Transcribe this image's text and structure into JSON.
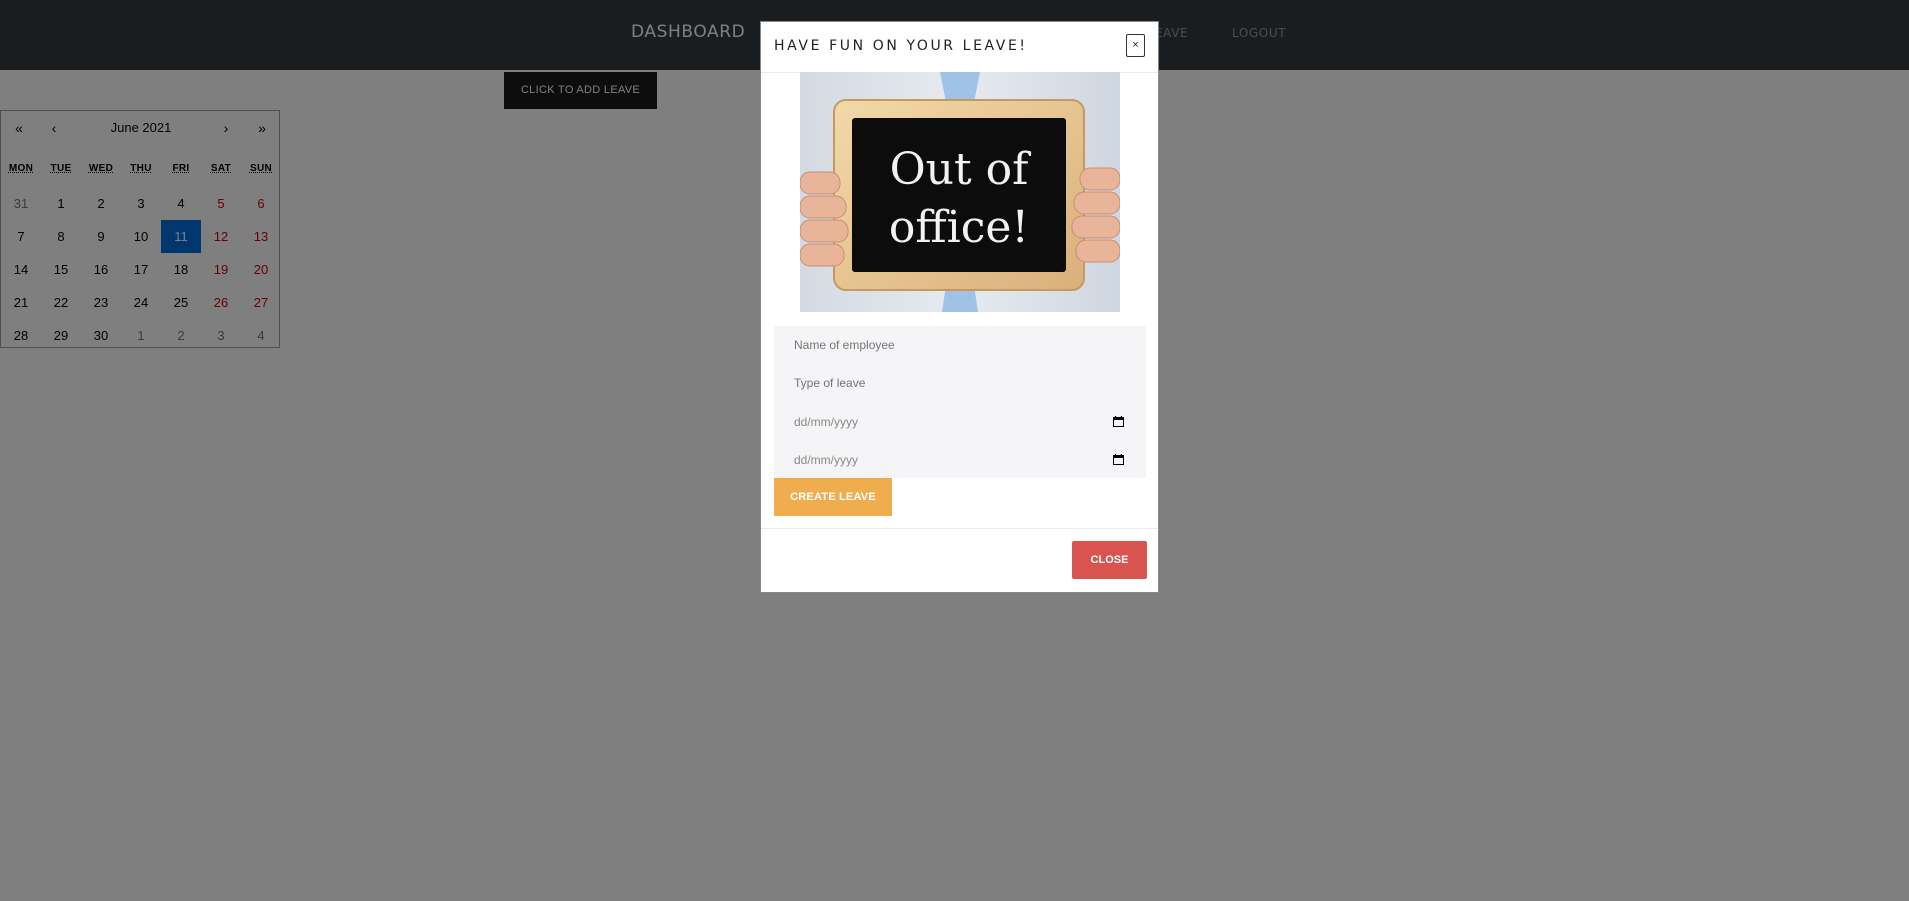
{
  "navbar": {
    "brand": "DASHBOARD",
    "links": [
      "EAVE",
      "LOGOUT"
    ]
  },
  "add_leave_button": "CLICK TO ADD LEAVE",
  "calendar": {
    "prev_year": "«",
    "prev_month": "‹",
    "label": "June 2021",
    "next_month": "›",
    "next_year": "»",
    "weekdays": [
      "MON",
      "TUE",
      "WED",
      "THU",
      "FRI",
      "SAT",
      "SUN"
    ],
    "days": [
      "31",
      "1",
      "2",
      "3",
      "4",
      "5",
      "6",
      "7",
      "8",
      "9",
      "10",
      "11",
      "12",
      "13",
      "14",
      "15",
      "16",
      "17",
      "18",
      "19",
      "20",
      "21",
      "22",
      "23",
      "24",
      "25",
      "26",
      "27",
      "28",
      "29",
      "30",
      "1",
      "2",
      "3",
      "4"
    ],
    "selected_day": "11",
    "colors": {
      "weekend": "#d10000",
      "neighbor": "#757575",
      "selected": "#006edc"
    }
  },
  "modal": {
    "title": "HAVE FUN ON YOUR LEAVE!",
    "close_x": "×",
    "image": {
      "sign_line1": "Out of",
      "sign_line2": "office!"
    },
    "form": {
      "name_placeholder": "Name of employee",
      "type_placeholder": "Type of leave",
      "start_date_placeholder": "dd/mm/yyyy",
      "end_date_placeholder": "dd/mm/yyyy",
      "create_button": "CREATE LEAVE"
    },
    "close_button": "CLOSE"
  },
  "colors": {
    "navbar": "#343a40",
    "create_button": "#f0ad4e",
    "close_button": "#d9534f"
  }
}
